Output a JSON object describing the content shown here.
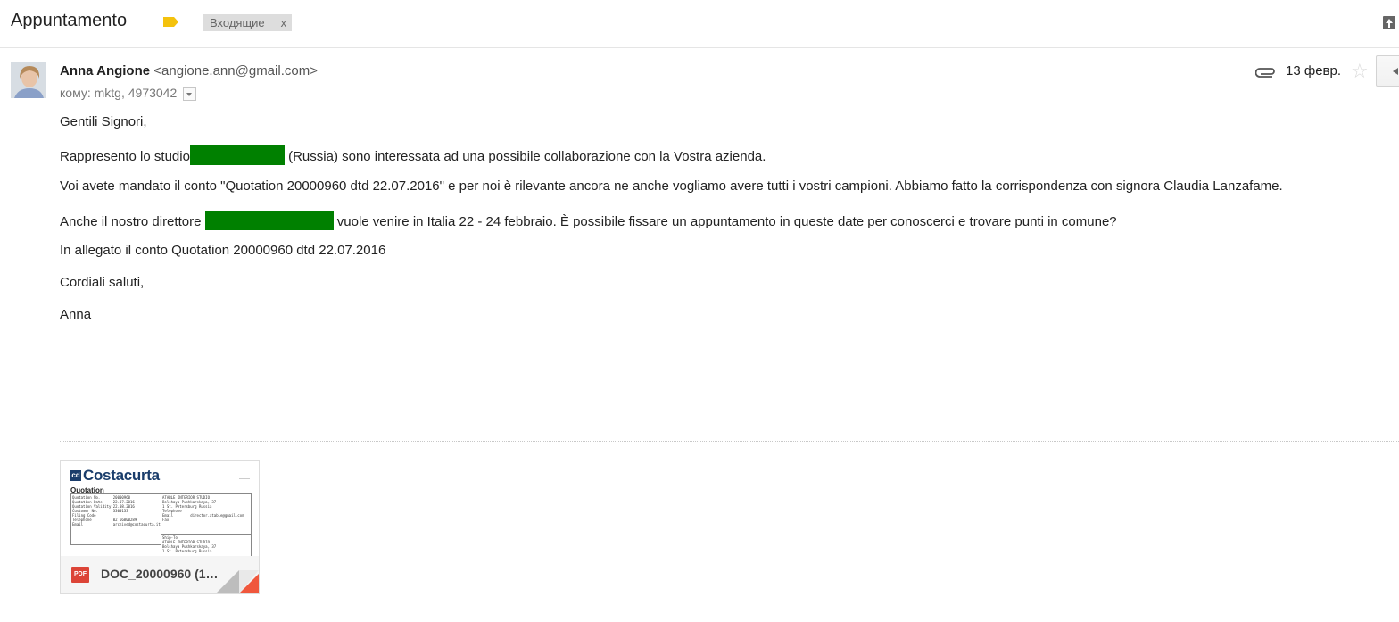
{
  "header": {
    "subject": "Appuntamento",
    "label": "Входящие",
    "label_remove": "x"
  },
  "sender": {
    "name": "Anna Angione",
    "email": "<angione.ann@gmail.com>",
    "to_line": "кому: mktg, 4973042",
    "date": "13 февр."
  },
  "body": {
    "greeting": "Gentili Signori,",
    "p1_before": "Rappresento lo studio",
    "p1_after": "(Russia) sono interessata ad una possibile collaborazione con la Vostra azienda.",
    "p2": "Voi avete mandato il conto \"Quotation 20000960 dtd 22.07.2016\" e per noi è rilevante ancora ne anche vogliamo avere tutti i vostri campioni. Abbiamo fatto la corrispondenza con signora Claudia Lanzafame.",
    "p3_before": "Anche il nostro direttore",
    "p3_after": "vuole venire in Italia 22 - 24 febbraio. È possibile fissare un appuntamento in queste date per conoscerci e trovare punti in comune?",
    "p4": "In allegato il conto Quotation 20000960 dtd 22.07.2016",
    "closing": "Cordiali saluti,",
    "signature": "Anna"
  },
  "attachment": {
    "file_name": "DOC_20000960 (1…",
    "file_type": "PDF",
    "preview": {
      "logo_text": "Costacurta",
      "heading": "Quotation",
      "left_block": "Quotation No.      20000960\nQuotation Date     22.07.2016\nQuotation Validity 22.08.2016\nCustomer No.       3300133\nFiling Code\nTelephone          02 66800289\nEmail              archived@costacurta.it",
      "right_block_1": "ATABLE INTERIOR STUDIO\nBolshaya Pushkarskaya, 37\n1 St. Petersburg Russia\nTelephone\nEmail        director.atable@gmail.com\nFax",
      "right_block_2": "Ship-To\nATABLE INTERIOR STUDIO\nBolshaya Pushkarskaya, 37\n1 St. Petersburg Russia"
    }
  },
  "colors": {
    "redaction": "#008000",
    "pdf_icon": "#dc4437",
    "important_marker": "#f4c20d"
  }
}
